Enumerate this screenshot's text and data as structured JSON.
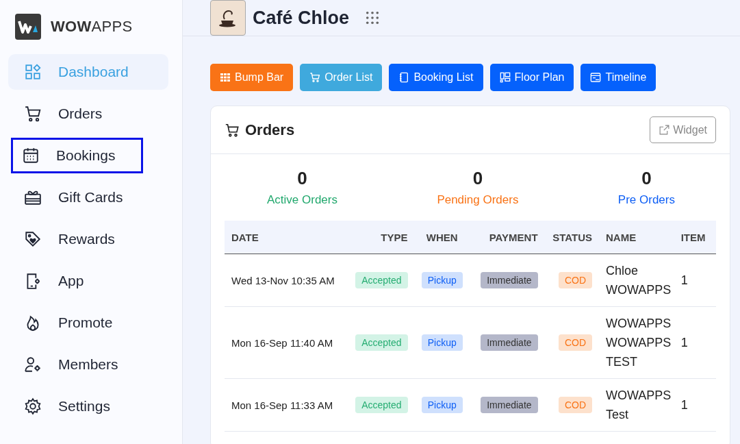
{
  "brand": {
    "logo_text": "**WOW**APPS"
  },
  "sidebar": {
    "items": [
      {
        "label": "Dashboard",
        "selected": true,
        "outlined": false
      },
      {
        "label": "Orders",
        "selected": false,
        "outlined": false
      },
      {
        "label": "Bookings",
        "selected": false,
        "outlined": true
      },
      {
        "label": "Gift Cards",
        "selected": false,
        "outlined": false
      },
      {
        "label": "Rewards",
        "selected": false,
        "outlined": false
      },
      {
        "label": "App",
        "selected": false,
        "outlined": false
      },
      {
        "label": "Promote",
        "selected": false,
        "outlined": false
      },
      {
        "label": "Members",
        "selected": false,
        "outlined": false
      },
      {
        "label": "Settings",
        "selected": false,
        "outlined": false
      }
    ]
  },
  "header": {
    "title": "Café Chloe"
  },
  "toolbar": [
    {
      "label": "Bump Bar",
      "color": "#f97316"
    },
    {
      "label": "Order List",
      "color": "#3fa9dd"
    },
    {
      "label": "Booking List",
      "color": "#0561fc"
    },
    {
      "label": "Floor Plan",
      "color": "#0561fc"
    },
    {
      "label": "Timeline",
      "color": "#0561fc"
    }
  ],
  "orders_card": {
    "title": "Orders",
    "widget_button": "Widget",
    "stats": [
      {
        "value": "0",
        "label": "Active Orders",
        "color": "#21a86d"
      },
      {
        "value": "0",
        "label": "Pending Orders",
        "color": "#f97316"
      },
      {
        "value": "0",
        "label": "Pre Orders",
        "color": "#0d5ef5"
      }
    ],
    "table": {
      "columns": [
        "DATE",
        "TYPE",
        "WHEN",
        "PAYMENT",
        "STATUS",
        "NAME",
        "ITEM"
      ],
      "rows": [
        {
          "date": "Wed 13-Nov 10:35 AM",
          "type": "Accepted",
          "when": "Pickup",
          "payment": "Immediate",
          "status": "COD",
          "name": "Chloe WOWAPPS",
          "items": "1"
        },
        {
          "date": "Mon 16-Sep 11:40 AM",
          "type": "Accepted",
          "when": "Pickup",
          "payment": "Immediate",
          "status": "COD",
          "name": "WOWAPPS WOWAPPS TEST",
          "items": "1"
        },
        {
          "date": "Mon 16-Sep 11:33 AM",
          "type": "Accepted",
          "when": "Pickup",
          "payment": "Immediate",
          "status": "COD",
          "name": "WOWAPPS Test",
          "items": "1"
        }
      ]
    }
  }
}
